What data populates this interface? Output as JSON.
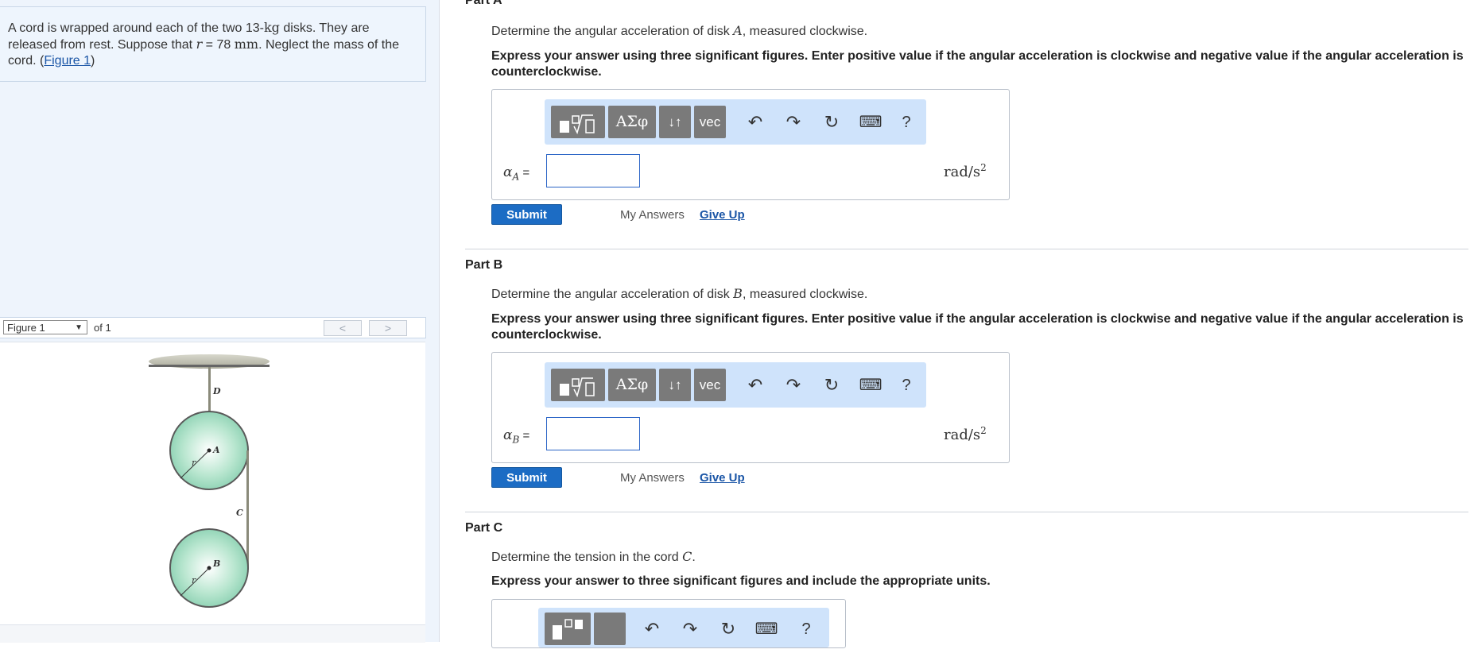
{
  "problem": {
    "text_1": "A cord is wrapped around each of the two 13-",
    "unit_kg": "kg",
    "text_2": " disks. They are released from rest. Suppose that ",
    "var_r": "r",
    "text_3": " = 78 ",
    "unit_mm": "mm",
    "text_4": ". Neglect the mass of the cord. (",
    "figure_link": "Figure 1",
    "text_5": ")"
  },
  "figure_nav": {
    "selected": "Figure 1",
    "of_text": "of 1",
    "prev": "<",
    "next": ">"
  },
  "figure_labels": {
    "D": "D",
    "A": "A",
    "C": "C",
    "B": "B",
    "r": "r"
  },
  "toolbar": {
    "greek": "ΑΣφ",
    "arrows": "↓↑",
    "vec": "vec",
    "undo": "↶",
    "redo": "↷",
    "reset": "↻",
    "keyboard": "⌨",
    "help": "?"
  },
  "parts": {
    "a": {
      "label": "Part A",
      "question_pre": "Determine the angular acceleration of disk ",
      "question_var": "A",
      "question_post": ", measured clockwise.",
      "instruction": "Express your answer using three significant figures. Enter positive value if the angular acceleration is clockwise and negative value if the angular acceleration is counterclockwise.",
      "var_symbol": "α",
      "var_sub": "A",
      "equals": " =",
      "unit": "rad/s",
      "unit_exp": "2",
      "submit": "Submit",
      "my_answers": "My Answers",
      "give_up": "Give Up"
    },
    "b": {
      "label": "Part B",
      "question_pre": "Determine the angular acceleration of disk ",
      "question_var": "B",
      "question_post": ", measured clockwise.",
      "instruction": "Express your answer using three significant figures. Enter positive value if the angular acceleration is clockwise and negative value if the angular acceleration is counterclockwise.",
      "var_symbol": "α",
      "var_sub": "B",
      "equals": " =",
      "unit": "rad/s",
      "unit_exp": "2",
      "submit": "Submit",
      "my_answers": "My Answers",
      "give_up": "Give Up"
    },
    "c": {
      "label": "Part C",
      "question_pre": "Determine the tension in the cord ",
      "question_var": "C",
      "question_post": ".",
      "instruction": "Express your answer to three significant figures and include the appropriate units."
    }
  }
}
